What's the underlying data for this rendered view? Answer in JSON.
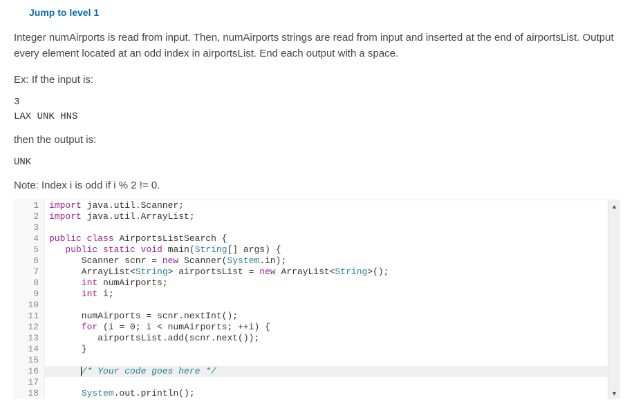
{
  "jump_link": "Jump to level 1",
  "problem": {
    "description": "Integer numAirports is read from input. Then, numAirports strings are read from input and inserted at the end of airportsList. Output every element located at an odd index in airportsList. End each output with a space.",
    "ex_label": "Ex: If the input is:",
    "input_line1": "3",
    "input_line2": "LAX UNK HNS",
    "then_label": "then the output is:",
    "output_line": "UNK",
    "note": "Note: Index i is odd if i % 2 != 0."
  },
  "code": {
    "lines": [
      {
        "n": 1,
        "tokens": [
          {
            "t": "keyword",
            "v": "import"
          },
          {
            "t": "plain",
            "v": " java.util.Scanner;"
          }
        ]
      },
      {
        "n": 2,
        "tokens": [
          {
            "t": "keyword",
            "v": "import"
          },
          {
            "t": "plain",
            "v": " java.util.ArrayList;"
          }
        ]
      },
      {
        "n": 3,
        "tokens": []
      },
      {
        "n": 4,
        "tokens": [
          {
            "t": "keyword",
            "v": "public"
          },
          {
            "t": "plain",
            "v": " "
          },
          {
            "t": "keyword",
            "v": "class"
          },
          {
            "t": "plain",
            "v": " AirportsListSearch {"
          }
        ]
      },
      {
        "n": 5,
        "tokens": [
          {
            "t": "plain",
            "v": "   "
          },
          {
            "t": "keyword",
            "v": "public"
          },
          {
            "t": "plain",
            "v": " "
          },
          {
            "t": "keyword",
            "v": "static"
          },
          {
            "t": "plain",
            "v": " "
          },
          {
            "t": "keyword",
            "v": "void"
          },
          {
            "t": "plain",
            "v": " main("
          },
          {
            "t": "type",
            "v": "String"
          },
          {
            "t": "plain",
            "v": "[] args) {"
          }
        ]
      },
      {
        "n": 6,
        "tokens": [
          {
            "t": "plain",
            "v": "      Scanner scnr = "
          },
          {
            "t": "keyword",
            "v": "new"
          },
          {
            "t": "plain",
            "v": " Scanner("
          },
          {
            "t": "type",
            "v": "System"
          },
          {
            "t": "plain",
            "v": ".in);"
          }
        ]
      },
      {
        "n": 7,
        "tokens": [
          {
            "t": "plain",
            "v": "      ArrayList<"
          },
          {
            "t": "type",
            "v": "String"
          },
          {
            "t": "plain",
            "v": "> airportsList = "
          },
          {
            "t": "keyword",
            "v": "new"
          },
          {
            "t": "plain",
            "v": " ArrayList<"
          },
          {
            "t": "type",
            "v": "String"
          },
          {
            "t": "plain",
            "v": ">();"
          }
        ]
      },
      {
        "n": 8,
        "tokens": [
          {
            "t": "plain",
            "v": "      "
          },
          {
            "t": "keyword",
            "v": "int"
          },
          {
            "t": "plain",
            "v": " numAirports;"
          }
        ]
      },
      {
        "n": 9,
        "tokens": [
          {
            "t": "plain",
            "v": "      "
          },
          {
            "t": "keyword",
            "v": "int"
          },
          {
            "t": "plain",
            "v": " i;"
          }
        ]
      },
      {
        "n": 10,
        "tokens": []
      },
      {
        "n": 11,
        "tokens": [
          {
            "t": "plain",
            "v": "      numAirports = scnr.nextInt();"
          }
        ]
      },
      {
        "n": 12,
        "tokens": [
          {
            "t": "plain",
            "v": "      "
          },
          {
            "t": "keyword",
            "v": "for"
          },
          {
            "t": "plain",
            "v": " (i = 0; i < numAirports; ++i) {"
          }
        ]
      },
      {
        "n": 13,
        "tokens": [
          {
            "t": "plain",
            "v": "         airportsList.add(scnr.next());"
          }
        ]
      },
      {
        "n": 14,
        "tokens": [
          {
            "t": "plain",
            "v": "      }"
          }
        ]
      },
      {
        "n": 15,
        "tokens": []
      },
      {
        "n": 16,
        "highlight": true,
        "cursor": true,
        "tokens": [
          {
            "t": "plain",
            "v": "      "
          },
          {
            "t": "comment",
            "v": "/* Your code goes here */"
          }
        ]
      },
      {
        "n": 17,
        "tokens": []
      },
      {
        "n": 18,
        "tokens": [
          {
            "t": "plain",
            "v": "      "
          },
          {
            "t": "type",
            "v": "System"
          },
          {
            "t": "plain",
            "v": ".out.println();"
          }
        ]
      }
    ]
  },
  "scrollbar": {
    "up_glyph": "▲",
    "down_glyph": "▼"
  }
}
